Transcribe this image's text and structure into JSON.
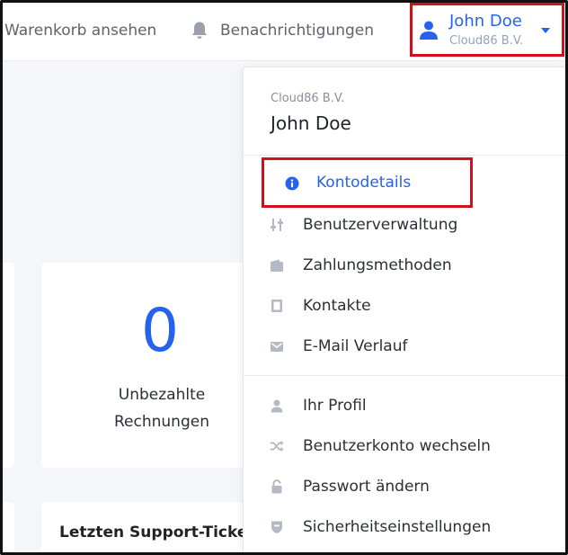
{
  "topbar": {
    "cart_label": "Warenkorb ansehen",
    "notifications_label": "Benachrichtigungen",
    "user": {
      "name": "John Doe",
      "company": "Cloud86 B.V."
    }
  },
  "dashboard": {
    "unpaid_invoices": {
      "count": "0",
      "label_line1": "Unbezahlte",
      "label_line2": "Rechnungen"
    },
    "tickets_title": "Letzten Support-Tickets"
  },
  "dropdown": {
    "company": "Cloud86 B.V.",
    "user": "John Doe",
    "account_items": [
      {
        "label": "Kontodetails",
        "icon": "info-icon",
        "active": true
      },
      {
        "label": "Benutzerverwaltung",
        "icon": "sliders-icon"
      },
      {
        "label": "Zahlungsmethoden",
        "icon": "wallet-icon"
      },
      {
        "label": "Kontakte",
        "icon": "address-book-icon"
      },
      {
        "label": "E-Mail Verlauf",
        "icon": "envelope-icon"
      }
    ],
    "profile_items": [
      {
        "label": "Ihr Profil",
        "icon": "user-icon"
      },
      {
        "label": "Benutzerkonto wechseln",
        "icon": "shuffle-icon"
      },
      {
        "label": "Passwort ändern",
        "icon": "lock-icon"
      },
      {
        "label": "Sicherheitseinstellungen",
        "icon": "shield-icon"
      }
    ]
  },
  "colors": {
    "accent": "#2563eb",
    "highlight": "#d0101a",
    "muted": "#94a3b8"
  }
}
